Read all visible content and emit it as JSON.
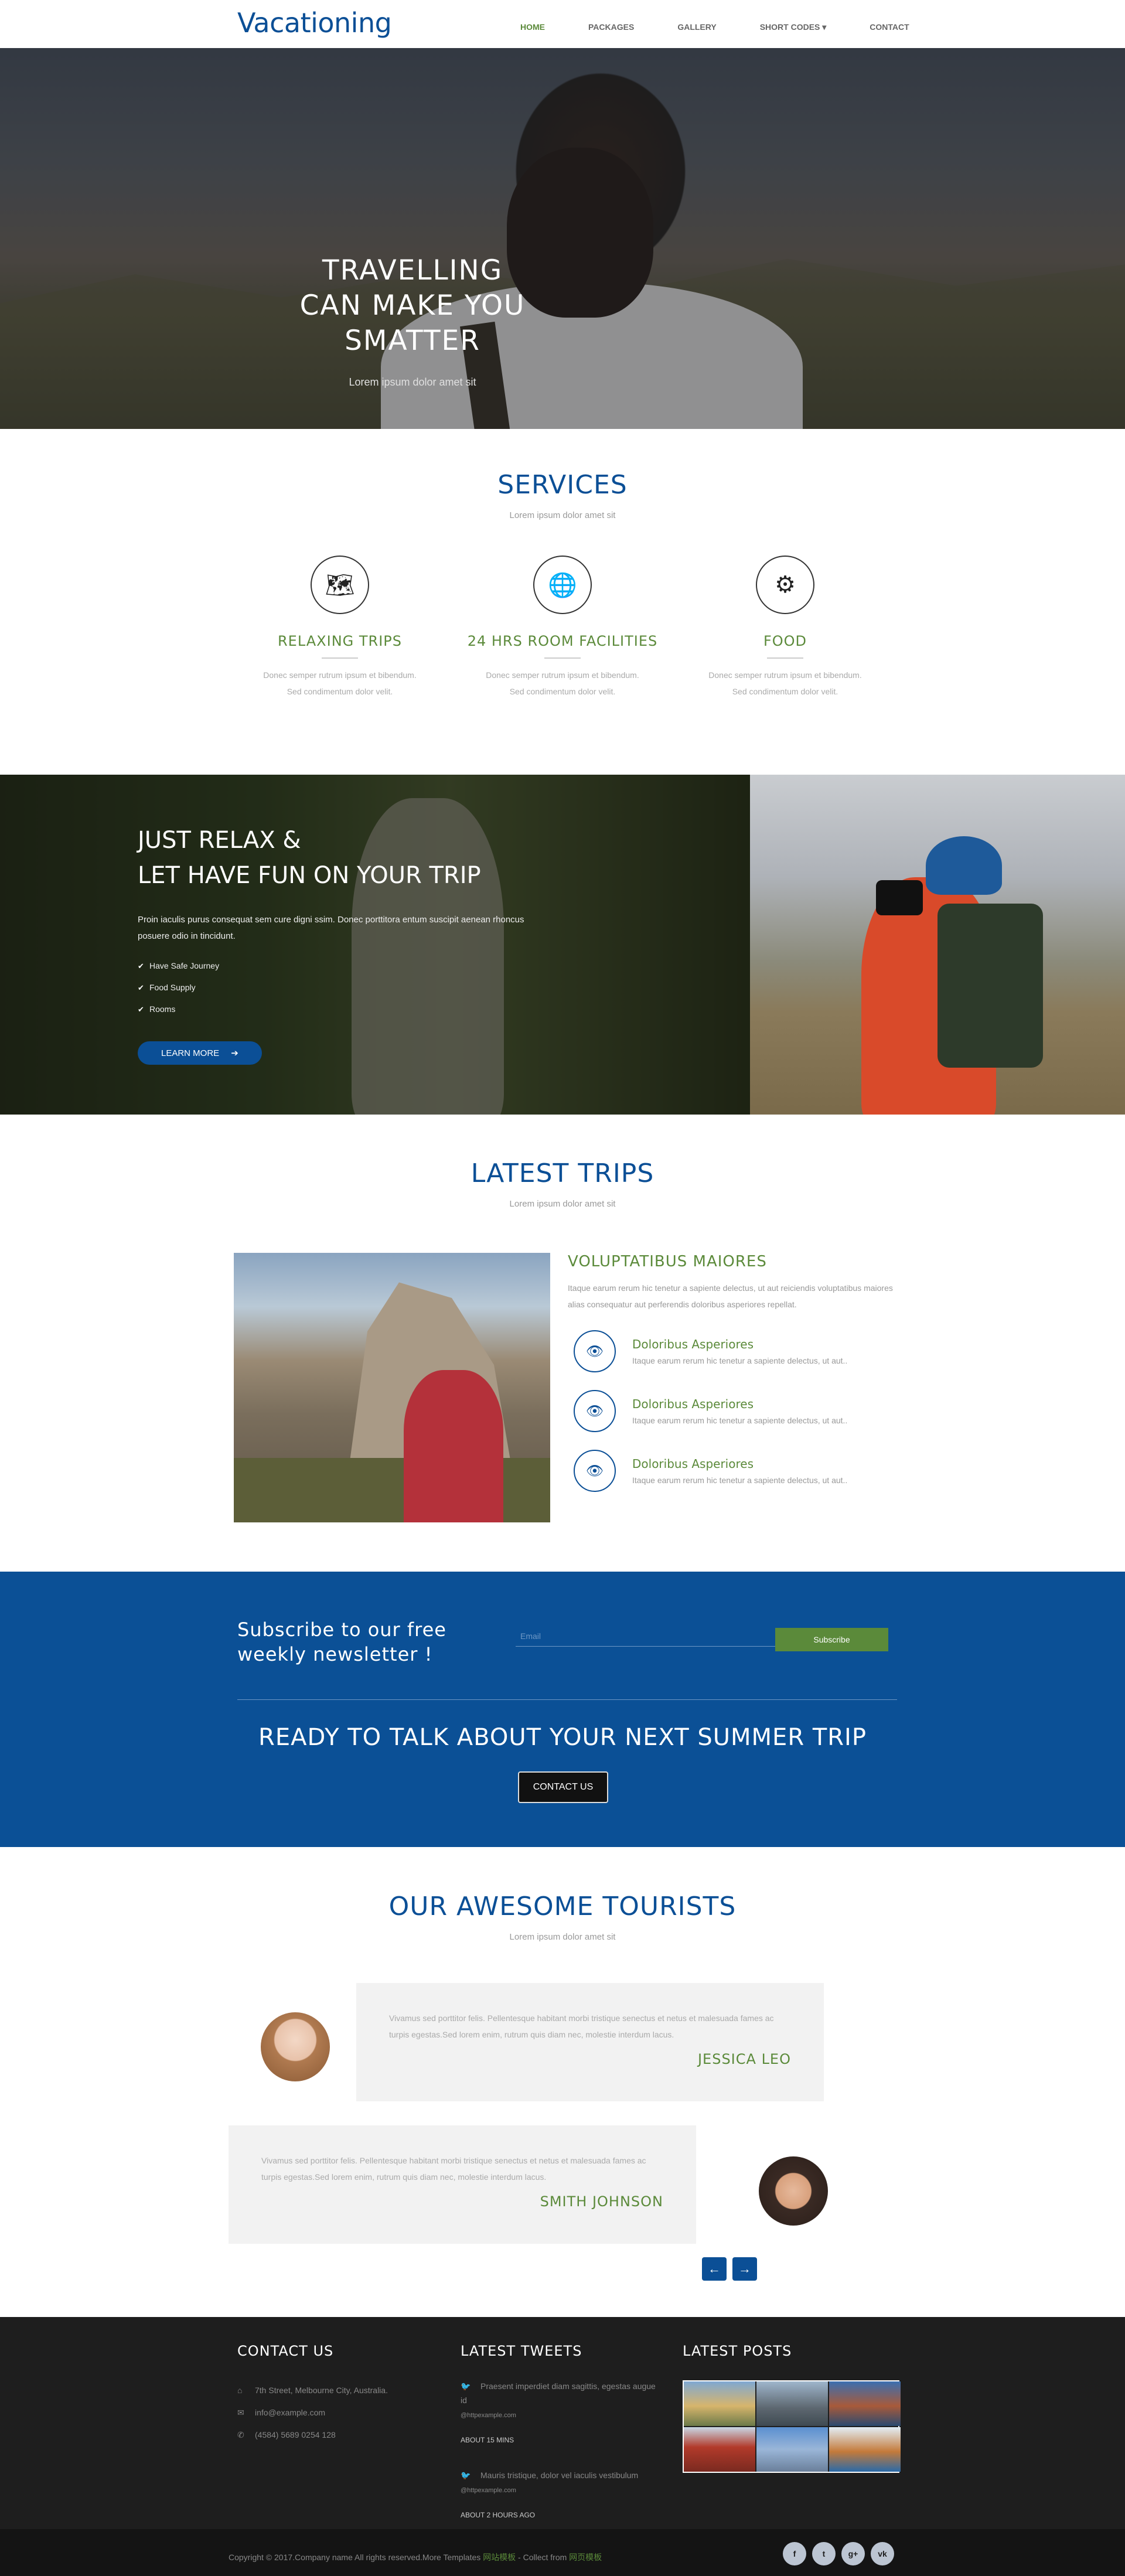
{
  "header": {
    "logo": "Vacationing",
    "nav": [
      {
        "label": "HOME"
      },
      {
        "label": "PACKAGES"
      },
      {
        "label": "GALLERY"
      },
      {
        "label": "SHORT CODES ▾"
      },
      {
        "label": "CONTACT"
      }
    ]
  },
  "hero": {
    "title_lines": [
      "TRAVELLING",
      "CAN MAKE YOU",
      "SMATTER"
    ],
    "subtitle": "Lorem ipsum dolor amet sit"
  },
  "services": {
    "title": "SERVICES",
    "subtitle": "Lorem ipsum dolor amet sit",
    "items": [
      {
        "icon": "map-icon",
        "glyph": "🗺",
        "title": "RELAXING TRIPS",
        "text_1": "Donec semper rutrum ipsum et bibendum.",
        "text_2": "Sed condimentum dolor velit."
      },
      {
        "icon": "globe-icon",
        "glyph": "🌐",
        "title": "24 HRS ROOM FACILITIES",
        "text_1": "Donec semper rutrum ipsum et bibendum.",
        "text_2": "Sed condimentum dolor velit."
      },
      {
        "icon": "gears-icon",
        "glyph": "⚙",
        "title": "FOOD",
        "text_1": "Donec semper rutrum ipsum et bibendum.",
        "text_2": "Sed condimentum dolor velit."
      }
    ]
  },
  "relax": {
    "title_lines": [
      "JUST RELAX &",
      "LET HAVE FUN ON YOUR TRIP"
    ],
    "text": "Proin iaculis purus consequat sem cure digni ssim. Donec porttitora entum suscipit aenean rhoncus posuere odio in tincidunt.",
    "list": [
      "Have Safe Journey",
      "Food Supply",
      "Rooms"
    ],
    "button": "LEARN MORE"
  },
  "trips": {
    "title": "LATEST TRIPS",
    "subtitle": "Lorem ipsum dolor amet sit",
    "heading": "VOLUPTATIBUS MAIORES",
    "desc": "Itaque earum rerum hic tenetur a sapiente delectus, ut aut reiciendis voluptatibus maiores alias consequatur aut perferendis doloribus asperiores repellat.",
    "items": [
      {
        "title": "Doloribus Asperiores",
        "text": "Itaque earum rerum hic tenetur a sapiente delectus, ut aut.."
      },
      {
        "title": "Doloribus Asperiores",
        "text": "Itaque earum rerum hic tenetur a sapiente delectus, ut aut.."
      },
      {
        "title": "Doloribus Asperiores",
        "text": "Itaque earum rerum hic tenetur a sapiente delectus, ut aut.."
      }
    ]
  },
  "newsletter": {
    "title_1": "Subscribe to our free",
    "title_2": "weekly newsletter !",
    "placeholder": "Email",
    "button": "Subscribe",
    "cta_title": "READY TO TALK ABOUT YOUR NEXT SUMMER TRIP",
    "cta_button": "CONTACT US"
  },
  "tourists": {
    "title": "OUR AWESOME TOURISTS",
    "subtitle": "Lorem ipsum dolor amet sit",
    "reviews": [
      {
        "text": "Vivamus sed porttitor felis. Pellentesque habitant morbi tristique senectus et netus et malesuada fames ac turpis egestas.Sed lorem enim, rutrum quis diam nec, molestie interdum lacus.",
        "name": "JESSICA LEO"
      },
      {
        "text": "Vivamus sed porttitor felis. Pellentesque habitant morbi tristique senectus et netus et malesuada fames ac turpis egestas.Sed lorem enim, rutrum quis diam nec, molestie interdum lacus.",
        "name": "SMITH JOHNSON"
      }
    ],
    "prev": "←",
    "next": "→"
  },
  "footer": {
    "contact_title": "CONTACT US",
    "address": "7th Street, Melbourne City, Australia.",
    "email": "info@example.com",
    "phone": "(4584) 5689 0254 128",
    "tweets_title": "LATEST TWEETS",
    "tweets": [
      {
        "text": "Praesent imperdiet diam sagittis, egestas augue id",
        "handle": "@httpexample.com",
        "ago": "ABOUT 15 MINS"
      },
      {
        "text": "Mauris tristique, dolor vel iaculis vestibulum",
        "handle": "@httpexample.com",
        "ago": "ABOUT 2 HOURS AGO"
      }
    ],
    "posts_title": "LATEST POSTS",
    "copyright_a": "Copyright © 2017.Company name All rights reserved.More Templates ",
    "copyright_link1": "网站模板",
    "copyright_b": " - Collect from ",
    "copyright_link2": "网页模板",
    "social": [
      "f",
      "t",
      "g+",
      "vk"
    ]
  },
  "colors": {
    "brand_blue": "#0b4f96",
    "accent_green": "#5b8a3a",
    "footer_bg": "#1e1e1e"
  }
}
